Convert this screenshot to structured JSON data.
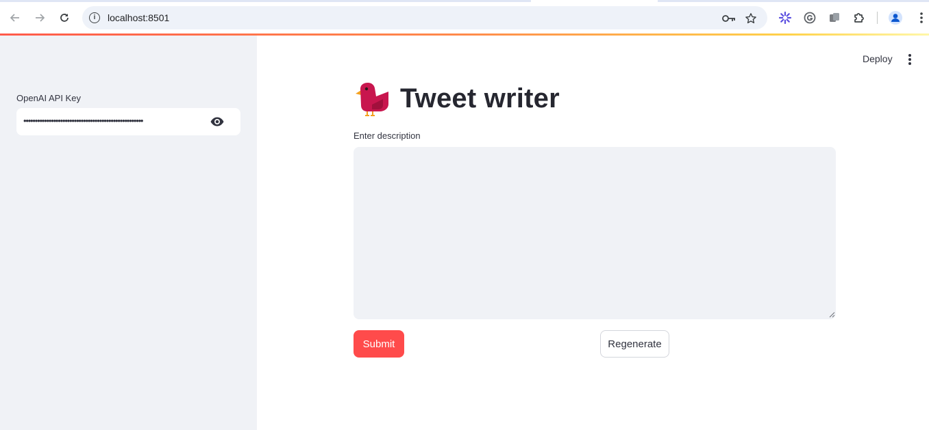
{
  "browser": {
    "url": "localhost:8501",
    "icons": [
      "back-icon",
      "forward-icon",
      "reload-icon",
      "site-info-icon",
      "password-key-icon",
      "bookmark-star-icon",
      "extension-sparkle-icon",
      "grammarly-icon",
      "extension-copy-icon",
      "extensions-puzzle-icon",
      "profile-avatar-icon",
      "chrome-menu-icon"
    ]
  },
  "sidebar": {
    "api_key_label": "OpenAI API Key",
    "api_key_value": "••••••••••••••••••••••••••••••••••••••••••••••••••••"
  },
  "header": {
    "deploy_label": "Deploy"
  },
  "main": {
    "title": "Tweet writer",
    "description_label": "Enter description",
    "description_value": "",
    "submit_label": "Submit",
    "regenerate_label": "Regenerate"
  },
  "colors": {
    "accent": "#ff4b4b",
    "sidebar_bg": "#f0f2f6",
    "text": "#31333f"
  }
}
